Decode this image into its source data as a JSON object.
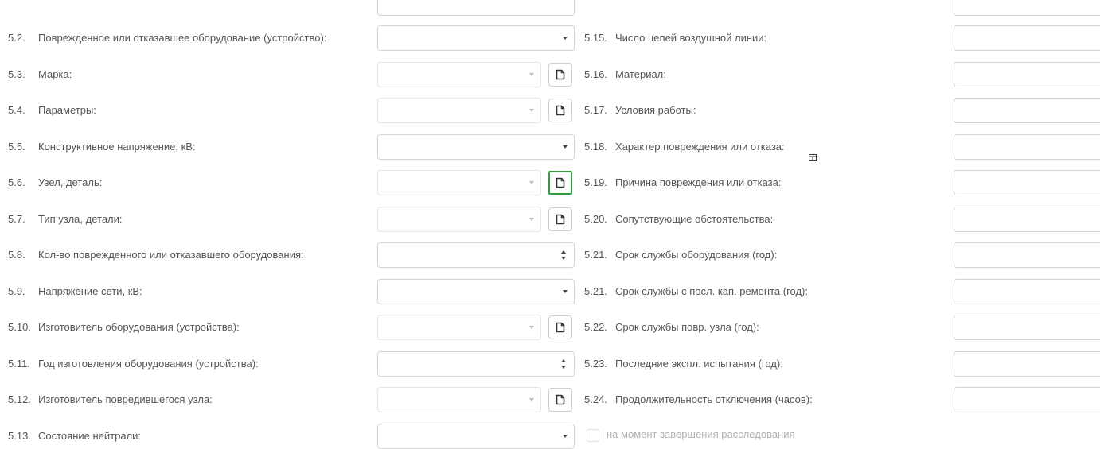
{
  "left_rows": [
    {
      "num": "5.2.",
      "label": "Поврежденное или отказавшее оборудование (устройство):",
      "control": "select"
    },
    {
      "num": "5.3.",
      "label": "Марка:",
      "control": "select-disabled-doc"
    },
    {
      "num": "5.4.",
      "label": "Параметры:",
      "control": "select-disabled-doc"
    },
    {
      "num": "5.5.",
      "label": "Конструктивное напряжение, кВ:",
      "control": "select"
    },
    {
      "num": "5.6.",
      "label": "Узел, деталь:",
      "control": "select-disabled-doc-focused"
    },
    {
      "num": "5.7.",
      "label": "Тип узла, детали:",
      "control": "select-disabled-doc"
    },
    {
      "num": "5.8.",
      "label": "Кол-во поврежденного или отказавшего оборудования:",
      "control": "number"
    },
    {
      "num": "5.9.",
      "label": "Напряжение сети, кВ:",
      "control": "select"
    },
    {
      "num": "5.10.",
      "label": "Изготовитель оборудования (устройства):",
      "control": "select-disabled-doc"
    },
    {
      "num": "5.11.",
      "label": "Год изготовления оборудования (устройства):",
      "control": "number"
    },
    {
      "num": "5.12.",
      "label": "Изготовитель повредившегося узла:",
      "control": "select-disabled-doc"
    },
    {
      "num": "5.13.",
      "label": "Состояние нейтрали:",
      "control": "select"
    }
  ],
  "right_rows": [
    {
      "num": "5.15.",
      "label": "Число цепей воздушной линии:"
    },
    {
      "num": "5.16.",
      "label": "Материал:"
    },
    {
      "num": "5.17.",
      "label": "Условия работы:"
    },
    {
      "num": "5.18.",
      "label": "Характер повреждения или отказа:"
    },
    {
      "num": "5.19.",
      "label": "Причина повреждения или отказа:"
    },
    {
      "num": "5.20.",
      "label": "Сопутствующие обстоятельства:"
    },
    {
      "num": "5.21.",
      "label": "Срок службы оборудования (год):"
    },
    {
      "num": "5.21.",
      "label": "Срок службы с посл. кап. ремонта (год):"
    },
    {
      "num": "5.22.",
      "label": "Срок службы повр. узла (год):"
    },
    {
      "num": "5.23.",
      "label": "Последние экспл. испытания (год):"
    },
    {
      "num": "5.24.",
      "label": "Продолжительность отключения (часов):"
    }
  ],
  "checkbox": {
    "label": "на момент завершения расследования",
    "checked": false
  },
  "icons": {
    "document": "document-icon",
    "dropdown": "chevron-down-icon",
    "spinner": "spinner-icon"
  },
  "colors": {
    "focus_outline": "#2e9d3a",
    "label_text": "#555555",
    "hint_text": "#b0b0b0",
    "border": "#d4d4d4"
  }
}
